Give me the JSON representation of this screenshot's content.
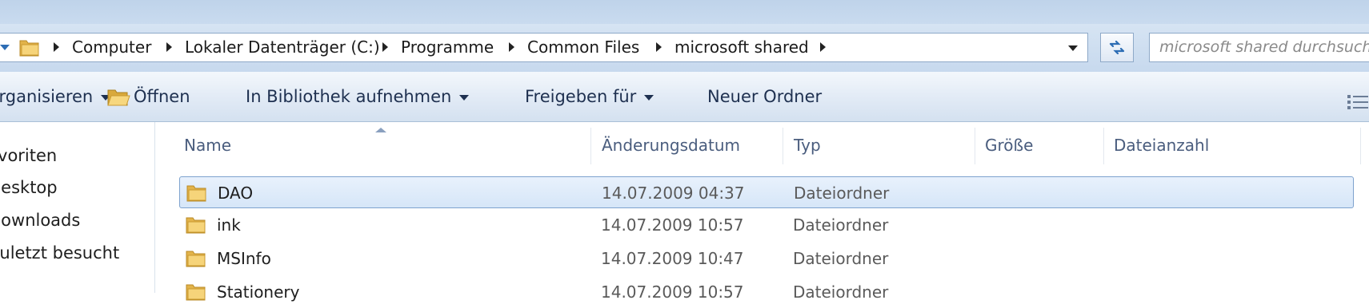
{
  "addressbar": {
    "breadcrumbs": [
      "Computer",
      "Lokaler Datenträger (C:)",
      "Programme",
      "Common Files",
      "microsoft shared"
    ],
    "search_placeholder": "microsoft shared durchsuchen"
  },
  "commandbar": {
    "organize_label": "Organisieren",
    "open_label": "Öffnen",
    "library_label": "In Bibliothek aufnehmen",
    "share_label": "Freigeben für",
    "newfolder_label": "Neuer Ordner"
  },
  "navpane": {
    "items": [
      "Favoriten",
      "Desktop",
      "Downloads",
      "Zuletzt besucht"
    ]
  },
  "columns": {
    "name": "Name",
    "date": "Änderungsdatum",
    "type": "Typ",
    "size": "Größe",
    "count": "Dateianzahl"
  },
  "files": [
    {
      "name": "DAO",
      "date": "14.07.2009 04:37",
      "type": "Dateiordner",
      "selected": true
    },
    {
      "name": "ink",
      "date": "14.07.2009 10:57",
      "type": "Dateiordner",
      "selected": false
    },
    {
      "name": "MSInfo",
      "date": "14.07.2009 10:47",
      "type": "Dateiordner",
      "selected": false
    },
    {
      "name": "Stationery",
      "date": "14.07.2009 10:57",
      "type": "Dateiordner",
      "selected": false
    }
  ],
  "icons": {
    "folder": "folder-icon",
    "refresh": "refresh-icon",
    "open": "open-folder-icon",
    "view": "view-options-icon"
  },
  "colors": {
    "accent": "#2d6db4",
    "selection": "#d6e6f8",
    "selection_border": "#7da2ce",
    "header_text": "#4a5d7e",
    "detail_text": "#5a5a5a"
  }
}
